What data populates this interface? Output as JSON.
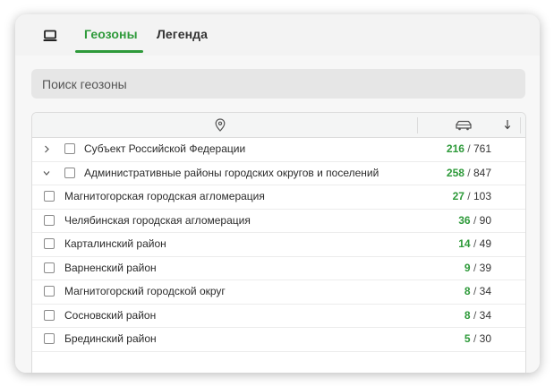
{
  "tabs": {
    "geozones": "Геозоны",
    "legend": "Легенда",
    "active": "geozones"
  },
  "search": {
    "placeholder": "Поиск геозоны",
    "value": ""
  },
  "table": {
    "columns": [
      "location-pin-icon",
      "vehicle-icon",
      "sort-arrow-icon"
    ],
    "rows": [
      {
        "level": 0,
        "expand": "collapsed",
        "name": "Субъект Российской Федерации",
        "on": "216",
        "sep": "/",
        "total": "761"
      },
      {
        "level": 0,
        "expand": "expanded",
        "name": "Административные районы городских округов и поселений",
        "on": "258",
        "sep": "/",
        "total": "847"
      },
      {
        "level": 1,
        "expand": "none",
        "name": "Магнитогорская городская агломерация",
        "on": "27",
        "sep": "/",
        "total": "103"
      },
      {
        "level": 1,
        "expand": "none",
        "name": "Челябинская городская агломерация",
        "on": "36",
        "sep": "/",
        "total": "90"
      },
      {
        "level": 1,
        "expand": "none",
        "name": "Карталинский район",
        "on": "14",
        "sep": "/",
        "total": "49"
      },
      {
        "level": 1,
        "expand": "none",
        "name": "Варненский район",
        "on": "9",
        "sep": "/",
        "total": "39"
      },
      {
        "level": 1,
        "expand": "none",
        "name": "Магнитогорский городской округ",
        "on": "8",
        "sep": "/",
        "total": "34"
      },
      {
        "level": 1,
        "expand": "none",
        "name": "Сосновский район",
        "on": "8",
        "sep": "/",
        "total": "34"
      },
      {
        "level": 1,
        "expand": "none",
        "name": "Брединский район",
        "on": "5",
        "sep": "/",
        "total": "30"
      }
    ]
  },
  "colors": {
    "accent": "#2e9a3a",
    "text": "#2b2b2b",
    "panel": "#f3f3f3"
  }
}
